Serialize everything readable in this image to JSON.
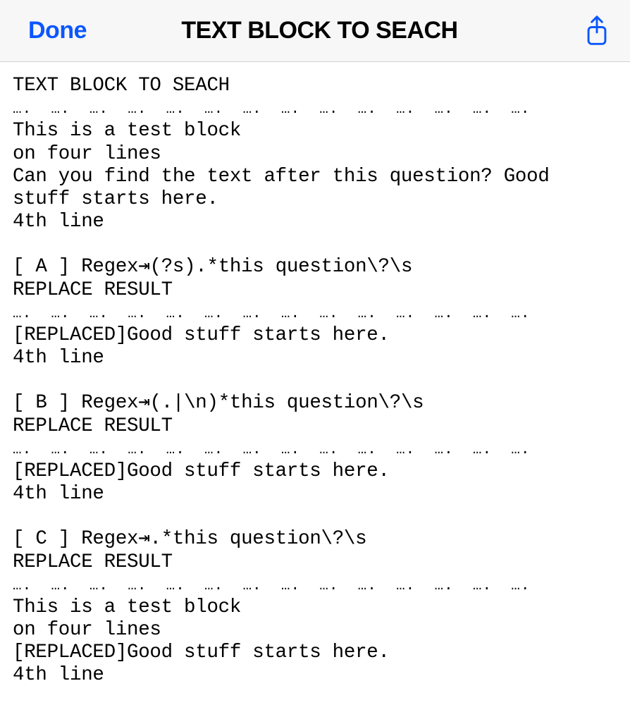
{
  "header": {
    "done_label": "Done",
    "title": "TEXT BLOCK TO SEACH"
  },
  "content": {
    "block_title": "TEXT BLOCK TO SEACH",
    "dots": "….  ….  ….  ….  ….  ….  ….  ….  ….  ….  ….  ….  ….  ….",
    "test_block_line1": "This is a test block",
    "test_block_line2": "on four lines",
    "test_block_line3": "Can you find the text after this question? Good stuff starts here.",
    "test_block_line4": "4th line",
    "section_a_header": "[ A ] Regex⇥(?s).*this question\\?\\s",
    "replace_result_label": "REPLACE RESULT",
    "section_a_result_line1": "[REPLACED]Good stuff starts here.",
    "section_a_result_line2": "4th line",
    "section_b_header": "[ B ] Regex⇥(.|\\n)*this question\\?\\s",
    "section_b_result_line1": "[REPLACED]Good stuff starts here.",
    "section_b_result_line2": "4th line",
    "section_c_header": "[ C ] Regex⇥.*this question\\?\\s",
    "section_c_result_line1": "This is a test block",
    "section_c_result_line2": "on four lines",
    "section_c_result_line3": "[REPLACED]Good stuff starts here.",
    "section_c_result_line4": "4th line"
  }
}
